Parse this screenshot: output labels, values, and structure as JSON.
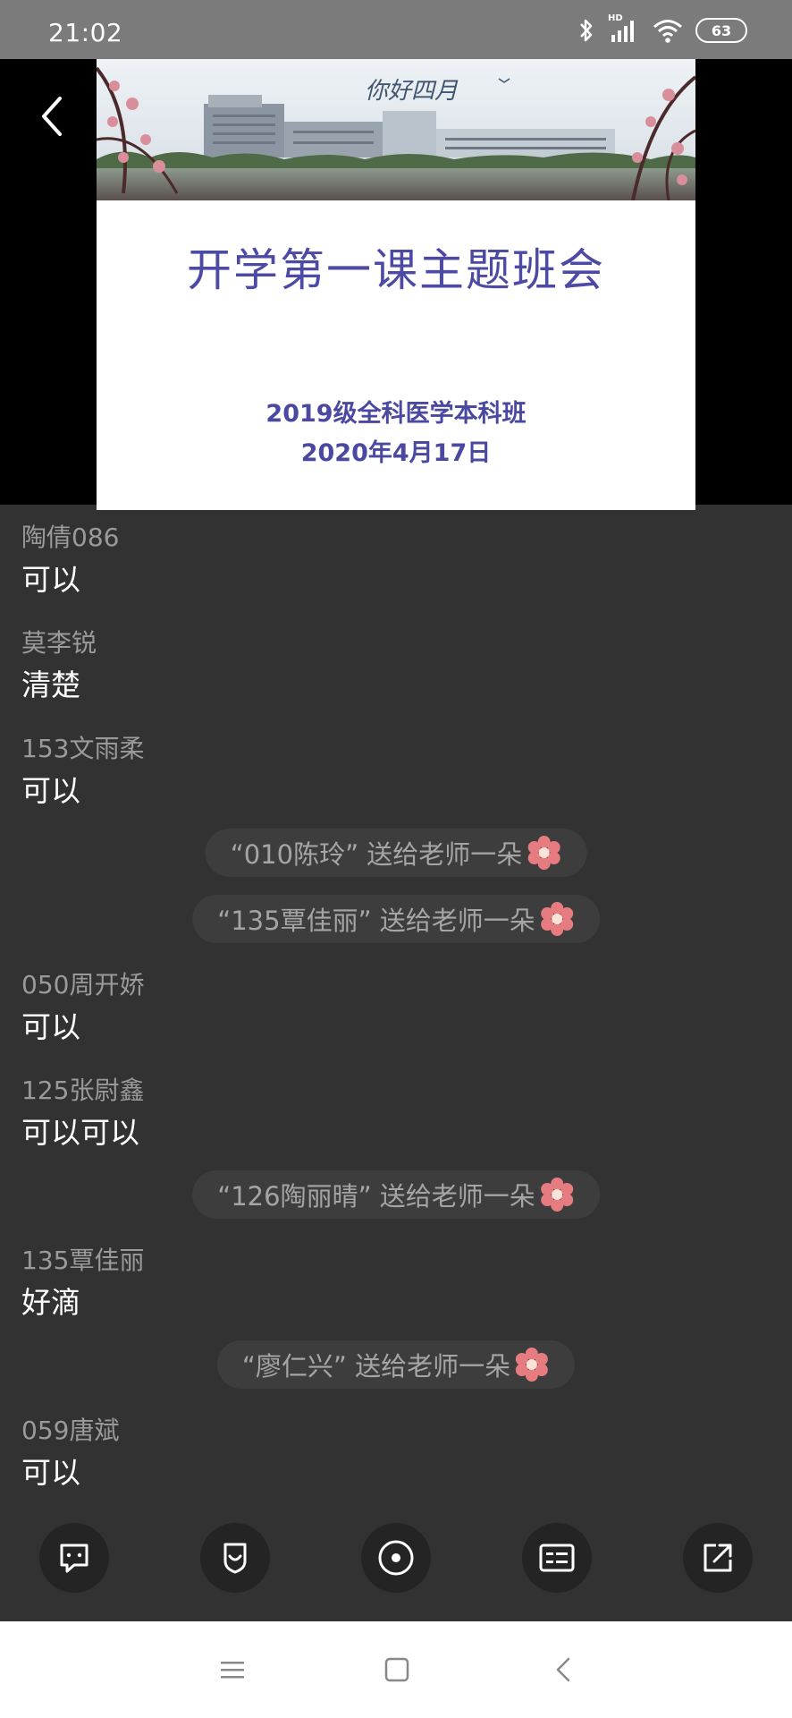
{
  "status_bar": {
    "time": "21:02",
    "signal_label": "HD",
    "battery": "63"
  },
  "slide": {
    "banner_text": "你好四月",
    "title": "开学第一课主题班会",
    "class_name": "2019级全科医学本科班",
    "date": "2020年4月17日"
  },
  "chat": {
    "messages": [
      {
        "author": "陶倩086",
        "text": "可以"
      },
      {
        "author": "莫李锐",
        "text": "清楚"
      },
      {
        "author": "153文雨柔",
        "text": "可以"
      },
      {
        "author": "050周开娇",
        "text": "可以"
      },
      {
        "author": "125张尉鑫",
        "text": "可以可以"
      },
      {
        "author": "135覃佳丽",
        "text": "好滴"
      },
      {
        "author": "059唐斌",
        "text": "可以"
      }
    ],
    "gifts": [
      {
        "text": "“010陈玲” 送给老师一朵"
      },
      {
        "text": "“135覃佳丽” 送给老师一朵"
      },
      {
        "text": "“126陶丽晴” 送给老师一朵"
      },
      {
        "text": "“廖仁兴” 送给老师一朵"
      }
    ]
  },
  "toolbar": [
    "chat-icon",
    "shield-icon",
    "target-icon",
    "card-icon",
    "share-icon"
  ],
  "navbar": [
    "menu-icon",
    "home-icon",
    "back-icon"
  ],
  "colors": {
    "background": "#323232",
    "slide_text": "#4c4aa4",
    "gift_bg": "#3d3d3d"
  }
}
